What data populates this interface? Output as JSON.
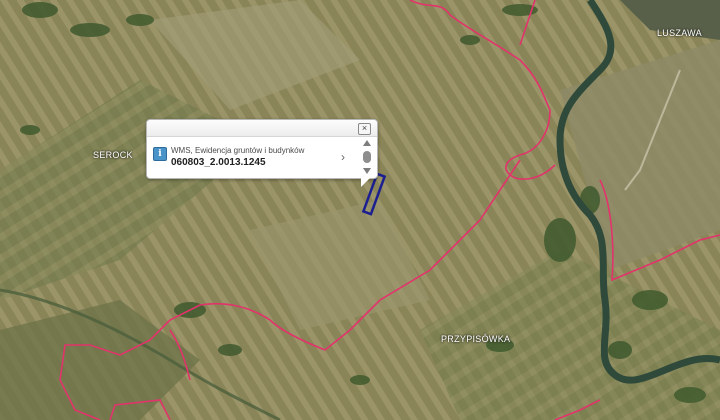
{
  "map": {
    "places": [
      "SEROCK",
      "LUSZAWA",
      "PRZYPISÓWKA"
    ],
    "colors": {
      "boundary": "#e2336b",
      "parcel_highlight": "#1c1f8f",
      "river": "#2f4a3a"
    }
  },
  "popup": {
    "info_icon": "i",
    "layer_name": "WMS, Ewidencja gruntów i budynków",
    "parcel_id": "060803_2.0013.1245",
    "close_glyph": "×",
    "next_glyph": "›"
  }
}
